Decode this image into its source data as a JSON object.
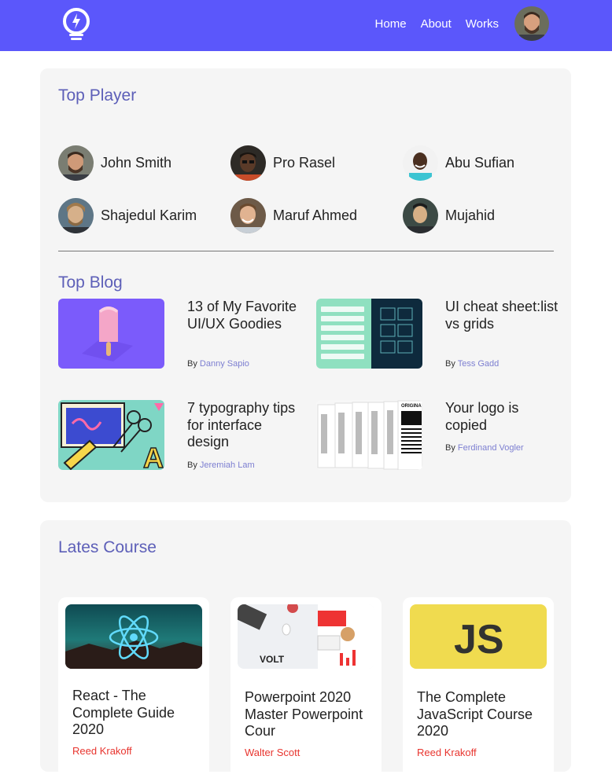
{
  "header": {
    "nav": [
      "Home",
      "About",
      "Works"
    ]
  },
  "top_player": {
    "title": "Top Player",
    "players": [
      "John Smith",
      "Pro Rasel",
      "Abu Sufian",
      "Shajedul Karim",
      "Maruf Ahmed",
      "Mujahid"
    ]
  },
  "top_blog": {
    "title": "Top Blog",
    "by_label": "By",
    "posts": [
      {
        "title": "13 of My Favorite UI/UX Goodies",
        "author": "Danny Sapio"
      },
      {
        "title": "UI cheat sheet:list vs grids",
        "author": "Tess Gadd"
      },
      {
        "title": "7 typography tips for interface design",
        "author": "Jeremiah Lam"
      },
      {
        "title": "Your logo is copied",
        "author": "Ferdinand Vogler"
      }
    ]
  },
  "latest_course": {
    "title": "Lates Course",
    "courses": [
      {
        "title": "React - The Complete Guide 2020",
        "author": "Reed Krakoff"
      },
      {
        "title": "Powerpoint 2020 Master Powerpoint Cour",
        "author": "Walter Scott"
      },
      {
        "title": "The Complete JavaScript Course 2020",
        "author": "Reed Krakoff"
      }
    ],
    "thumb_text": {
      "volt": "VOLT",
      "js": "JS",
      "origina": "ORIGINA"
    }
  },
  "colors": {
    "header": "#5b57fb",
    "accent": "#5d5fb8",
    "author_link": "#7d7fd1",
    "course_author": "#e8352f"
  }
}
